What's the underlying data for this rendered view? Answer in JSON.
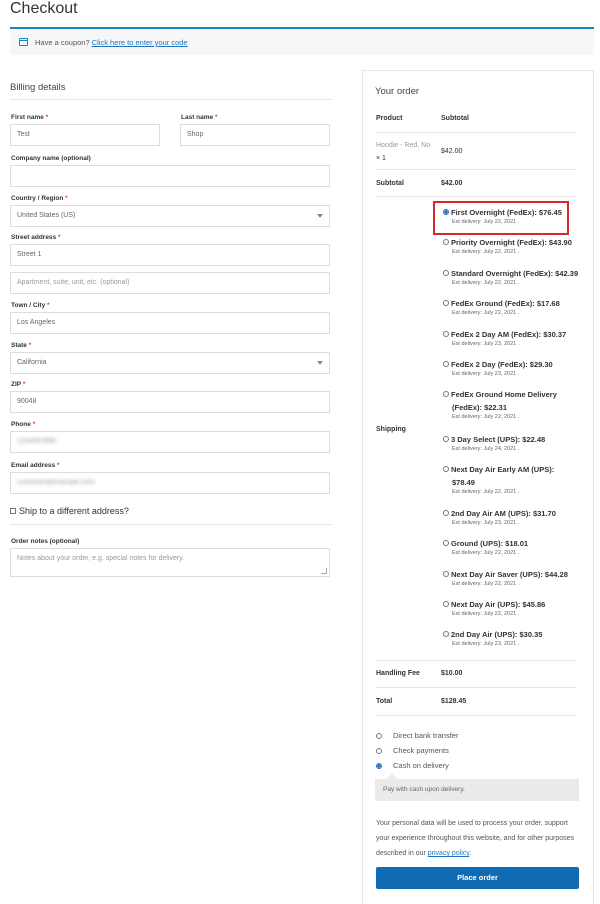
{
  "page": {
    "title": "Checkout"
  },
  "coupon": {
    "prompt": "Have a coupon?",
    "link": "Click here to enter your code",
    "icon": "calendar-icon",
    "accent": "#1e85be"
  },
  "billing": {
    "heading": "Billing details",
    "first_name": {
      "label": "First name",
      "value": "Test"
    },
    "last_name": {
      "label": "Last name",
      "value": "Shop"
    },
    "company": {
      "label": "Company name (optional)",
      "value": ""
    },
    "country": {
      "label": "Country / Region",
      "value": "United States (US)"
    },
    "street": {
      "label": "Street address",
      "value": "Street 1",
      "placeholder2": "Apartment, suite, unit, etc. (optional)"
    },
    "city": {
      "label": "Town / City",
      "value": "Los Angeles"
    },
    "state": {
      "label": "State",
      "value": "California"
    },
    "zip": {
      "label": "ZIP",
      "value": "90048"
    },
    "phone": {
      "label": "Phone",
      "value": "1234567890"
    },
    "email": {
      "label": "Email address",
      "value": "customer@example.com"
    },
    "required_mark": "*"
  },
  "shipping_diff": {
    "label": "Ship to a different address?"
  },
  "order_notes": {
    "label": "Order notes (optional)",
    "placeholder": "Notes about your order, e.g. special notes for delivery."
  },
  "order": {
    "heading": "Your order",
    "col_product": "Product",
    "col_subtotal": "Subtotal",
    "product_name": "Hoodie - Red, No",
    "product_qty": "× 1",
    "product_subtotal": "$42.00",
    "subtotal_label": "Subtotal",
    "subtotal_value": "$42.00",
    "shipping_label": "Shipping",
    "shipping_options": [
      {
        "name": "First Overnight (FedEx): $76.45",
        "est": "Est delivery: July 22, 2021 .",
        "selected": true
      },
      {
        "name": "Priority Overnight (FedEx): $43.90",
        "est": "Est delivery: July 22, 2021 .",
        "selected": false
      },
      {
        "name": "Standard Overnight (FedEx): $42.39",
        "est": "Est delivery: July 22, 2021 .",
        "selected": false
      },
      {
        "name": "FedEx Ground (FedEx): $17.68",
        "est": "Est delivery: July 22, 2021 .",
        "selected": false
      },
      {
        "name": "FedEx 2 Day AM (FedEx): $30.37",
        "est": "Est delivery: July 23, 2021 .",
        "selected": false
      },
      {
        "name": "FedEx 2 Day (FedEx): $29.30",
        "est": "Est delivery: July 23, 2021 .",
        "selected": false
      },
      {
        "name_line1": "FedEx Ground Home Delivery",
        "name_line2": "(FedEx): $22.31",
        "est": "Est delivery: July 22, 2021 .",
        "selected": false
      },
      {
        "name": "3 Day Select (UPS): $22.48",
        "est": "Est delivery: July 24, 2021 .",
        "selected": false
      },
      {
        "name_line1": "Next Day Air Early AM (UPS):",
        "name_line2": "$78.49",
        "est": "Est delivery: July 22, 2021 .",
        "selected": false
      },
      {
        "name": "2nd Day Air AM (UPS): $31.70",
        "est": "Est delivery: July 23, 2021 .",
        "selected": false
      },
      {
        "name": "Ground (UPS): $18.01",
        "est": "Est delivery: July 22, 2021 .",
        "selected": false
      },
      {
        "name": "Next Day Air Saver (UPS): $44.28",
        "est": "Est delivery: July 22, 2021 .",
        "selected": false
      },
      {
        "name": "Next Day Air (UPS): $45.86",
        "est": "Est delivery: July 22, 2021 .",
        "selected": false
      },
      {
        "name": "2nd Day Air (UPS): $30.35",
        "est": "Est delivery: July 23, 2021 .",
        "selected": false
      }
    ],
    "handling_label": "Handling Fee",
    "handling_value": "$10.00",
    "total_label": "Total",
    "total_value": "$128.45"
  },
  "payment": {
    "methods": [
      "Direct bank transfer",
      "Check payments",
      "Cash on delivery"
    ],
    "selected_index": 2,
    "description": "Pay with cash upon delivery."
  },
  "privacy": {
    "text": "Your personal data will be used to process your order, support your experience throughout this website, and for other purposes described in our",
    "link": "privacy policy",
    "end": "."
  },
  "place_order": {
    "label": "Place order",
    "color": "#0e6bb4"
  },
  "colors": {
    "required": "#e2401c",
    "link": "#1e73be",
    "highlight": "#d9262b"
  }
}
